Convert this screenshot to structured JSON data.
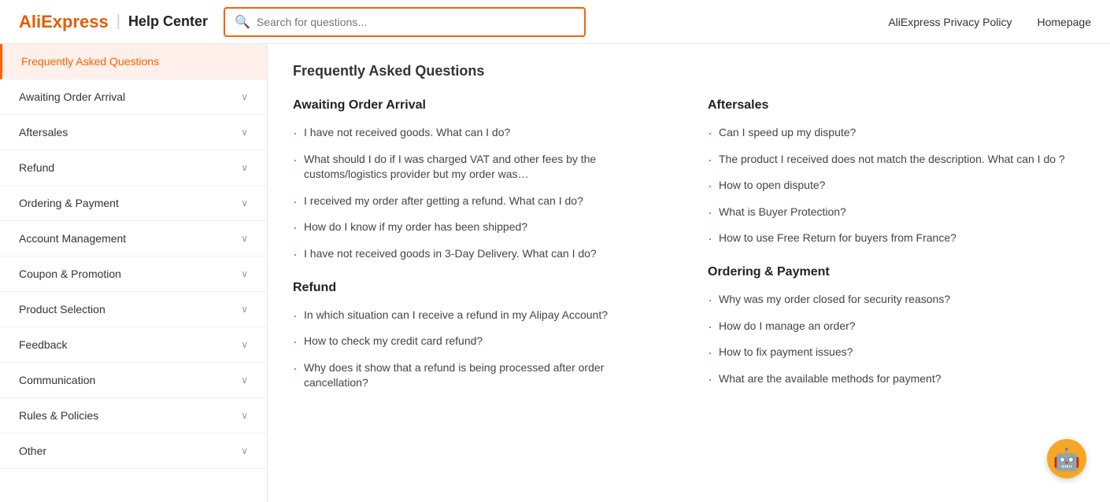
{
  "header": {
    "logo_aliexpress": "AliExpress",
    "logo_divider": "|",
    "logo_helpcenter": "Help Center",
    "search_placeholder": "Search for questions...",
    "nav_links": [
      {
        "label": "AliExpress Privacy Policy",
        "name": "privacy-policy-link"
      },
      {
        "label": "Homepage",
        "name": "homepage-link"
      }
    ]
  },
  "sidebar": {
    "items": [
      {
        "label": "Frequently Asked Questions",
        "active": true,
        "name": "frequently-asked-questions"
      },
      {
        "label": "Awaiting Order Arrival",
        "active": false,
        "name": "awaiting-order-arrival"
      },
      {
        "label": "Aftersales",
        "active": false,
        "name": "aftersales"
      },
      {
        "label": "Refund",
        "active": false,
        "name": "refund"
      },
      {
        "label": "Ordering & Payment",
        "active": false,
        "name": "ordering-payment"
      },
      {
        "label": "Account Management",
        "active": false,
        "name": "account-management"
      },
      {
        "label": "Coupon & Promotion",
        "active": false,
        "name": "coupon-promotion"
      },
      {
        "label": "Product Selection",
        "active": false,
        "name": "product-selection"
      },
      {
        "label": "Feedback",
        "active": false,
        "name": "feedback"
      },
      {
        "label": "Communication",
        "active": false,
        "name": "communication"
      },
      {
        "label": "Rules & Policies",
        "active": false,
        "name": "rules-policies"
      },
      {
        "label": "Other",
        "active": false,
        "name": "other"
      }
    ]
  },
  "main": {
    "page_title": "Frequently Asked Questions",
    "sections": [
      {
        "title": "Awaiting Order Arrival",
        "name": "awaiting-order-arrival-section",
        "column": 0,
        "items": [
          "I have not received goods. What can I do?",
          "What should I do if I was charged VAT and other fees by the customs/logistics provider but my order was…",
          "I received my order after getting a refund. What can I do?",
          "How do I know if my order has been shipped?",
          "I have not received goods in 3-Day Delivery. What can I do?"
        ]
      },
      {
        "title": "Aftersales",
        "name": "aftersales-section",
        "column": 1,
        "items": [
          "Can I speed up my dispute?",
          "The product I received does not match the description. What can I do ?",
          "How to open dispute?",
          "What is Buyer Protection?",
          "How to use Free Return for buyers from France?"
        ]
      },
      {
        "title": "Refund",
        "name": "refund-section",
        "column": 0,
        "items": [
          "In which situation can I receive a refund in my Alipay Account?",
          "How to check my credit card refund?",
          "Why does it show that a refund is being processed after order cancellation?"
        ]
      },
      {
        "title": "Ordering & Payment",
        "name": "ordering-payment-section",
        "column": 1,
        "items": [
          "Why was my order closed for security reasons?",
          "How do I manage an order?",
          "How to fix payment issues?",
          "What are the available methods for payment?"
        ]
      }
    ]
  },
  "robot": {
    "emoji": "🤖"
  }
}
